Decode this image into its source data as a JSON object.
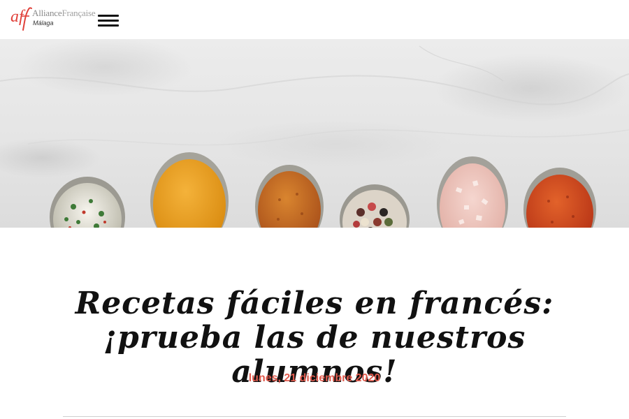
{
  "header": {
    "logo": {
      "mark": "af",
      "name_part1": "Alliance",
      "name_part2": "Française",
      "city": "Málaga"
    },
    "menu_icon": "hamburger-menu-icon"
  },
  "hero": {
    "image_subject": "spices-on-spoons-image"
  },
  "article": {
    "title": "Recetas fáciles en francés: ¡prueba las de nuestros alumnos!",
    "date": "lunes, 21 diciembre 2020"
  },
  "colors": {
    "brand_red": "#e0413a",
    "date_color": "#e05a4d",
    "title_color": "#111111"
  }
}
